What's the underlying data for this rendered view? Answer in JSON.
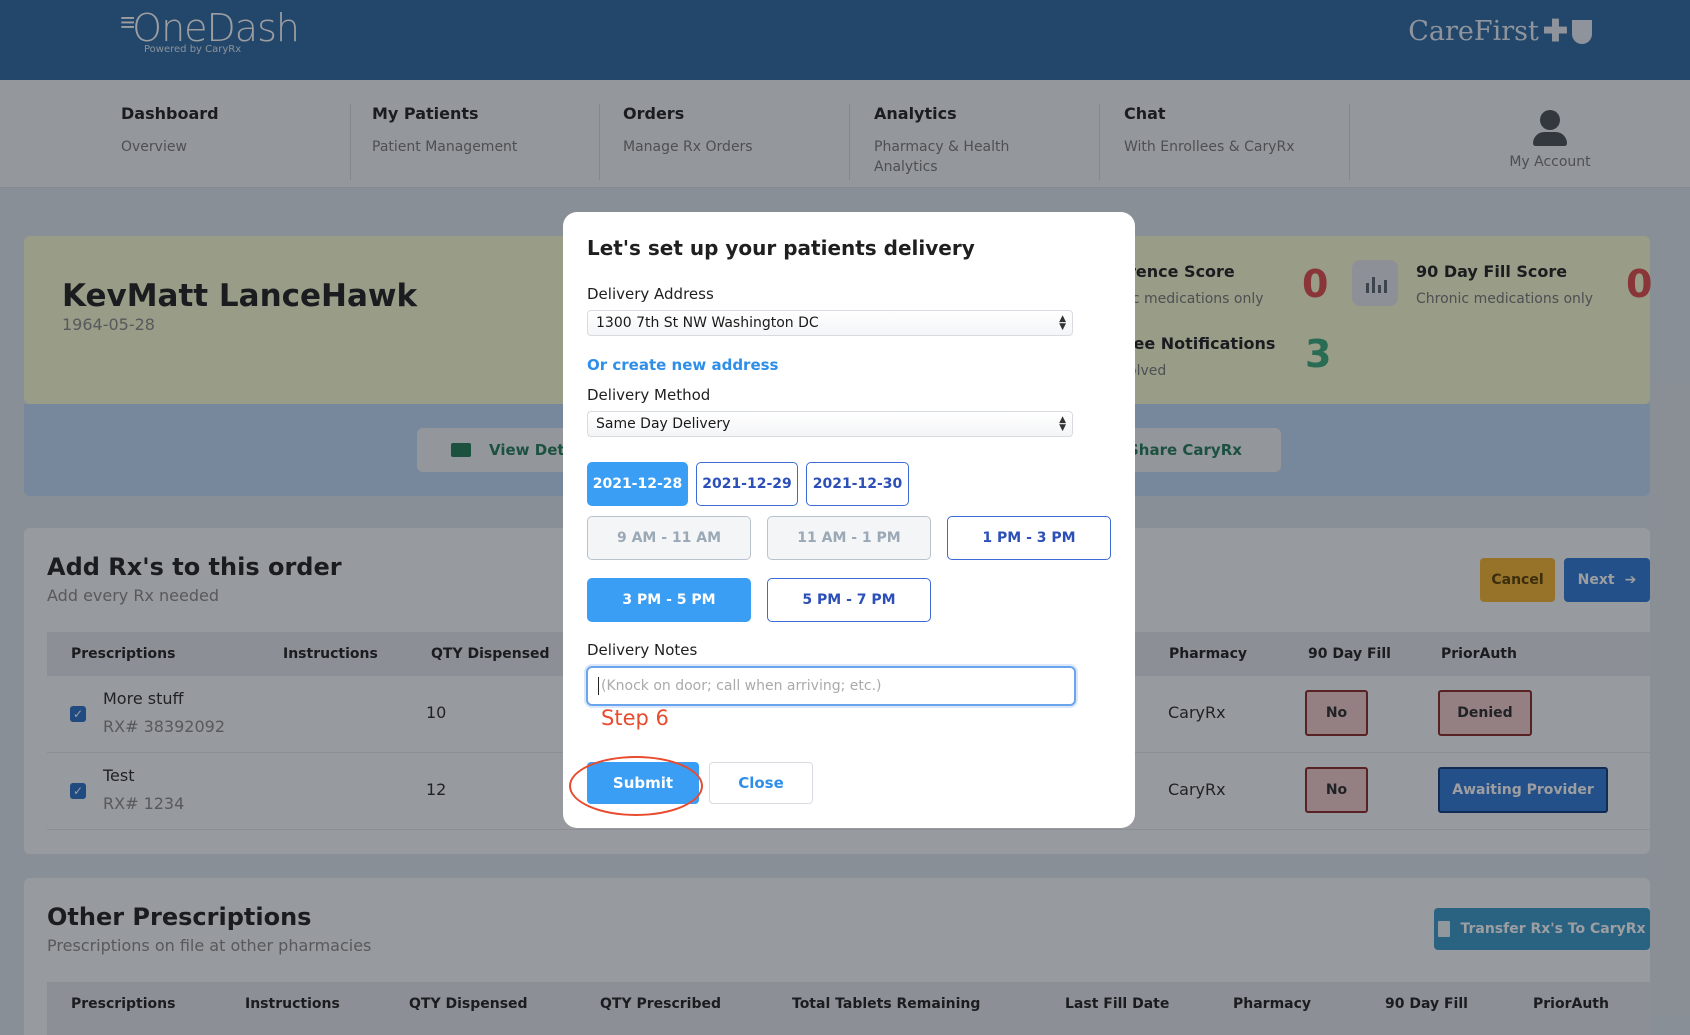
{
  "header": {
    "logo": "OneDash",
    "logo_prefix": "≡",
    "powered_by": "Powered by CaryRx",
    "partner_logo": "CareFirst"
  },
  "nav": {
    "items": [
      {
        "title": "Dashboard",
        "subtitle": "Overview"
      },
      {
        "title": "My Patients",
        "subtitle": "Patient Management"
      },
      {
        "title": "Orders",
        "subtitle": "Manage Rx Orders"
      },
      {
        "title": "Analytics",
        "subtitle": "Pharmacy & Health Analytics"
      },
      {
        "title": "Chat",
        "subtitle": "With Enrollees & CaryRx"
      }
    ],
    "account_label": "My Account"
  },
  "patient": {
    "name": "KevMatt LanceHawk",
    "dob": "1964-05-28",
    "adherence_title": "rence Score",
    "adherence_sub": "ic medications only",
    "adherence_value": "0",
    "fill_title": "90 Day Fill Score",
    "fill_sub": "Chronic medications only",
    "fill_value": "0",
    "notif_title": "lee Notifications",
    "notif_sub": "olved",
    "notif_value": "3",
    "view_details": "View Detai",
    "share": "Share CaryRx"
  },
  "colors": {
    "red": "#e04a4a",
    "green": "#3ba77a"
  },
  "order": {
    "title": "Add Rx's to this order",
    "subtitle": "Add every Rx needed",
    "cancel": "Cancel",
    "next": "Next",
    "columns": [
      "Prescriptions",
      "Instructions",
      "QTY Dispensed",
      "Pharmacy",
      "90 Day Fill",
      "PriorAuth"
    ],
    "rows": [
      {
        "name": "More stuff",
        "rx": "RX# 38392092",
        "qty": "10",
        "pharmacy": "CaryRx",
        "fill90": "No",
        "prior": "Denied"
      },
      {
        "name": "Test",
        "rx": "RX# 1234",
        "qty": "12",
        "pharmacy": "CaryRx",
        "fill90": "No",
        "prior": "Awaiting Provider"
      }
    ]
  },
  "other": {
    "title": "Other Prescriptions",
    "subtitle": "Prescriptions on file at other pharmacies",
    "transfer": "Transfer Rx's To CaryRx",
    "columns": [
      "Prescriptions",
      "Instructions",
      "QTY Dispensed",
      "QTY Prescribed",
      "Total Tablets Remaining",
      "Last Fill Date",
      "Pharmacy",
      "90 Day Fill",
      "PriorAuth"
    ]
  },
  "modal": {
    "title": "Let's set up your patients delivery",
    "address_label": "Delivery Address",
    "address_value": "1300 7th St NW Washington DC",
    "new_address": "Or create new address",
    "method_label": "Delivery Method",
    "method_value": "Same Day Delivery",
    "dates": [
      "2021-12-28",
      "2021-12-29",
      "2021-12-30"
    ],
    "times": [
      "9 AM - 11 AM",
      "11 AM - 1 PM",
      "1 PM - 3 PM",
      "3 PM - 5 PM",
      "5 PM - 7 PM"
    ],
    "notes_label": "Delivery Notes",
    "notes_placeholder": "(Knock on door; call when arriving; etc.)",
    "step": "Step 6",
    "submit": "Submit",
    "close": "Close"
  }
}
